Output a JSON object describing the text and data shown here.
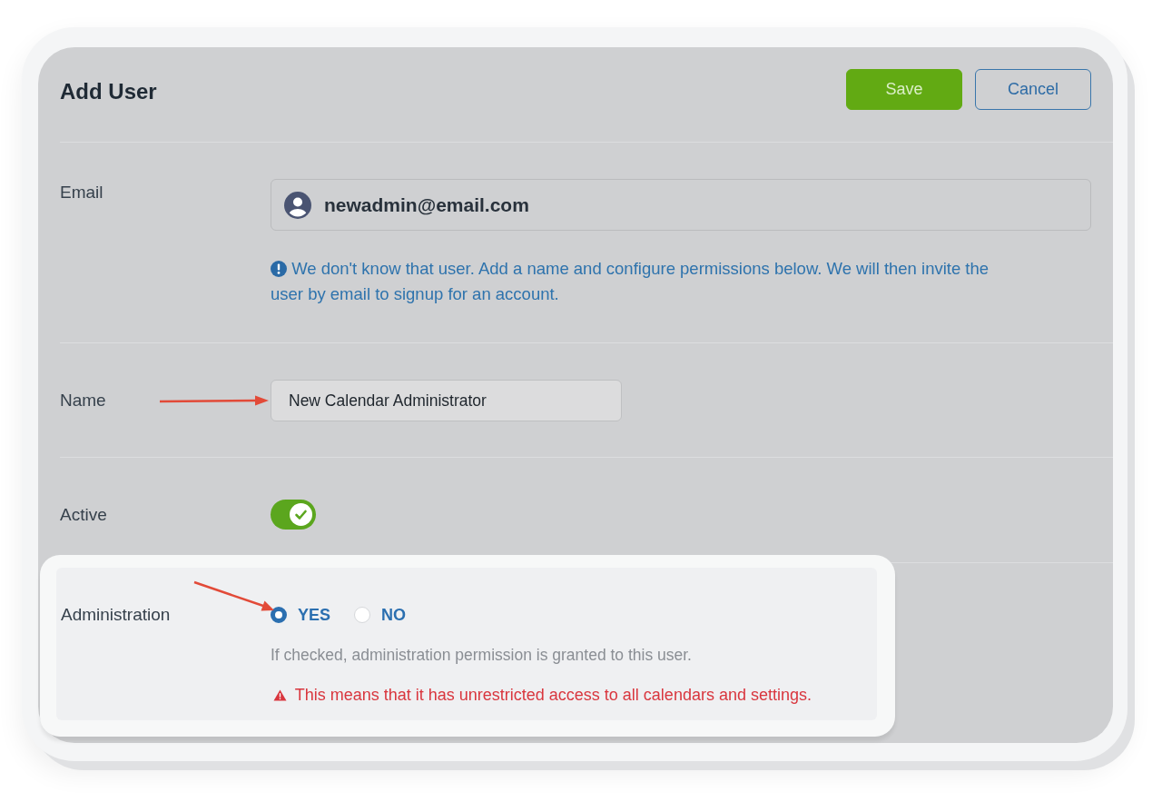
{
  "header": {
    "title": "Add User",
    "buttons": [
      {
        "label": "Save",
        "kind": "primary"
      },
      {
        "label": "Cancel",
        "kind": "secondary"
      }
    ]
  },
  "fields": [
    {
      "kind": "email",
      "label": "Email",
      "value": "newadmin@email.com",
      "info": "We don't know that user. Add a name and configure permissions below. We will then invite the user by email to signup for an account.",
      "highlighted": false,
      "annotated": false
    },
    {
      "kind": "text",
      "label": "Name",
      "value": "New Calendar Administrator",
      "highlighted": false,
      "annotated": true
    },
    {
      "kind": "toggle",
      "label": "Active",
      "on": true,
      "highlighted": false,
      "annotated": false
    },
    {
      "kind": "radio",
      "label": "Administration",
      "options": [
        {
          "label": "YES",
          "selected": true
        },
        {
          "label": "NO",
          "selected": false
        }
      ],
      "hint": "If checked, administration permission is granted to this user.",
      "warning": "This means that it has unrestricted access to all calendars and settings.",
      "highlighted": true,
      "annotated": true
    }
  ]
}
